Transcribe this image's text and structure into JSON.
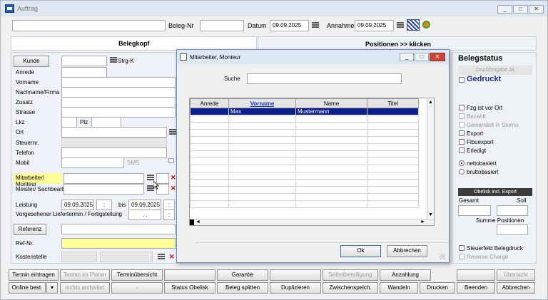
{
  "window": {
    "title": "Auftrag"
  },
  "header": {
    "beleg_label": "Beleg-Nr",
    "datum_label": "Datum",
    "datum_value": "09.09.2025",
    "annahme_label": "Annahme",
    "annahme_value": "09.09.2025"
  },
  "tabs": {
    "left": "Belegkopf",
    "right": "Positionen >> klicken"
  },
  "belegkopf": {
    "kunde_button": "Kunde",
    "strgk": "Strg-K",
    "anrede": "Anrede",
    "vorname": "Vorname",
    "nachname": "Nachname/Firma",
    "zusatz": "Zusatz",
    "strasse": "Strasse",
    "lkz": "Lkz",
    "plz": "Plz",
    "ort": "Ort",
    "steuernr": "Steuernr.",
    "telefon": "Telefon",
    "mobil": "Mobil",
    "sms": "SMS",
    "mitarbeiter": "Mitarbeiter/ Monteur",
    "meister": "Meister/ Sachbearb.",
    "leistung": "Leistung",
    "leistung_von": "09.09.2025",
    "bis": "bis",
    "leistung_bis": "09.09.2025",
    "liefertermin": "Vorgesehener Liefertermin / Fertigstellung",
    "liefer_dots": ". .",
    "referenz_button": "Referenz",
    "refnr": "Ref-Nr.",
    "kostenstelle": "Kostenstelle"
  },
  "status": {
    "title": "Belegstatus",
    "druckfreigabe": "Druckfreigabe JA",
    "gedruckt": "Gedruckt",
    "checks": [
      "Fzg ist vor Ort",
      "Bezahlt",
      "Gewandelt in Storno",
      "Export",
      "Fibuexport",
      "Erledigt"
    ],
    "netto": "nettobasiert",
    "brutto": "bruttobasiert",
    "obelisk": "Obelisk incl. Export",
    "gesamt": "Gesamt",
    "soll": "Soll",
    "summe": "Summe Positionen",
    "steuerfeld": "Steuerfeld Belegdruck",
    "reverse": "Reverse Charge"
  },
  "dialog": {
    "title": "Mitarbeiter, Monteur",
    "search_label": "Suche",
    "columns": [
      "Anrede",
      "Vorname",
      "Name",
      "Titel"
    ],
    "rows": [
      {
        "anrede": "",
        "vorname": "Max",
        "name": "Mustermann",
        "titel": ""
      }
    ],
    "ok": "Ok",
    "cancel": "Abbrechen"
  },
  "toolbar": {
    "row1": [
      "Termin eintragen",
      "Termin im Planer",
      "Terminübersicht",
      "",
      "Garantie",
      "",
      "Selbstbeteiligung",
      "Anzahlung",
      "",
      "Übersicht"
    ],
    "row2": [
      "Online best.",
      "nichts archiviert",
      "-",
      "Status Obelisk",
      "Beleg splitten",
      "Duplizieren",
      "Zwischenspeich.",
      "Wandeln",
      "Drucken",
      "Beenden",
      "Abbrechen"
    ]
  }
}
